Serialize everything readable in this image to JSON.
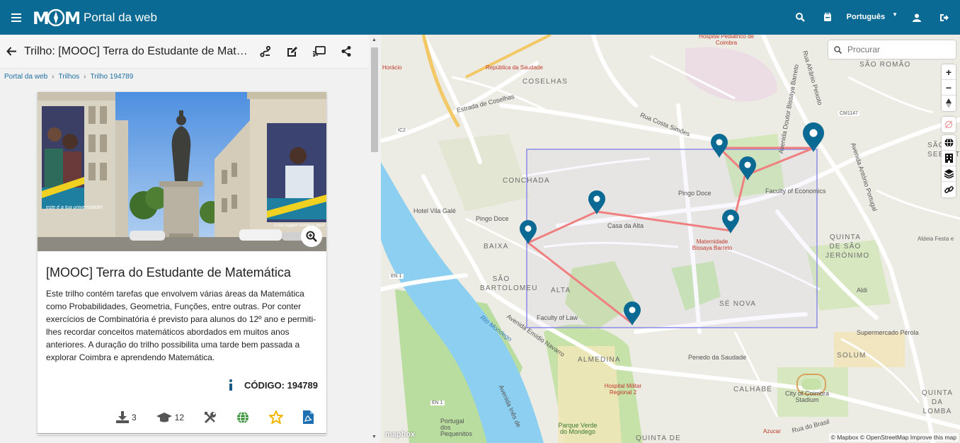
{
  "header": {
    "logo_text": "MCM",
    "title": "Portal da web",
    "language": "Português"
  },
  "trail": {
    "title": "Trilho: [MOOC] Terra do Estudante de Matemática",
    "breadcrumb": [
      "Portal da web",
      "Trilhos",
      "Trilho 194789"
    ],
    "name": "[MOOC] Terra do Estudante de Matemática",
    "description": "Este trilho contém tarefas que envolvem várias áreas da Matemática como Probabilidades, Geometria, Funções, entre outras. Por conter exercícios de Combinatória é previsto para alunos do 12º ano e permiti-lhes recordar conceitos matemáticos abordados em muitos anos anteriores. A duração do trilho possibilita uma tarde bem passada a explorar Coimbra e aprendendo Matemática.",
    "code_label": "CÓDIGO: 194789",
    "downloads": "3",
    "students": "12",
    "banner_text_left": "este é a tua universidade!",
    "banner_text_right": "a tua viagem começa aqui!"
  },
  "map": {
    "search_placeholder": "Procurar",
    "attribution": "© Mapbox © OpenStreetMap Improve this map",
    "mapbox_logo": "mapbox",
    "labels": {
      "coselhas": "COSELHAS",
      "sao_romao": "SÃO ROMÃO",
      "republica": "República da Saudade",
      "horacio": "Horácio",
      "hosp_ped": "Hospital Pediátrico de Coimbra",
      "estrada_coselhas": "Estrada de Coselhas",
      "rua_costa_simoes": "Rua Costa Simões",
      "rua_aranio": "Rua Afrânio Peixoto",
      "av_bissaya": "Avenida Doutor Bissaya Barreto",
      "conchada": "CONCHADA",
      "pingo_doce_1": "Pingo Doce",
      "pingo_doce_2": "Pingo Doce",
      "hotel": "Hotel Vila Galé",
      "faculty_econ": "Faculty of Economics",
      "casa_alta": "Casa da Alta",
      "maternidade": "Maternidade Bissaya Barreto",
      "baixa": "BAIXA",
      "sao_bartolomeu": "SÃO BARTOLOMEU",
      "alta": "ALTA",
      "faculty_law": "Faculty of Law",
      "se_nova": "SÉ NOVA",
      "quinta_sj": "QUINTA DE SÃO JERÓNIMO",
      "sao_sebast": "SÃO SEBAST",
      "av_antonio_portugal": "Avenida António Portugal",
      "aldeia": "Aldeia Festa e",
      "aldi": "Aldi",
      "rio_mondego": "Rio Mondego",
      "av_emidio": "Avenida Emídio Navarro",
      "almedina": "ALMEDINA",
      "hosp_militar": "Hospital Militar Regional 2",
      "penedo": "Penedo da Saudade",
      "supermercado": "Supermercado Pérola",
      "solum": "SOLUM",
      "calhabe": "CALHABÉ",
      "stadium": "City of Coimbra Stadium",
      "quinta_lomba": "QUINTA DA LOMBA",
      "portugal_pequenitos": "Portugal dos Pequenitos",
      "parque_verde": "Parque Verde do Mondego",
      "quinta_de": "QUINTA DE",
      "azucar": "Azucar",
      "rua_brasil": "Rua do Brasil",
      "en1_a": "EN 1",
      "en1_b": "EN 1",
      "ic2": "IC2",
      "cm1147": "CM1147",
      "av_ines": "Avenida Inês de"
    }
  },
  "colors": {
    "topbar": "#0b6a93",
    "marker": "#0b6a93",
    "route": "#f08080",
    "bbox": "#8a8ae8",
    "river": "#8dcff0",
    "park": "#b8dea0"
  },
  "icons": [
    "menu-icon",
    "search-icon",
    "bag-icon",
    "user-icon",
    "logout-icon",
    "back-arrow-icon",
    "route-icon",
    "edit-icon",
    "cast-icon",
    "share-icon",
    "zoom-in-icon",
    "info-icon",
    "download-icon",
    "graduation-cap-icon",
    "tools-icon",
    "globe-icon",
    "star-icon",
    "pdf-icon",
    "building-icon",
    "layers-icon",
    "link-icon",
    "compass-icon",
    "no-location-icon"
  ]
}
